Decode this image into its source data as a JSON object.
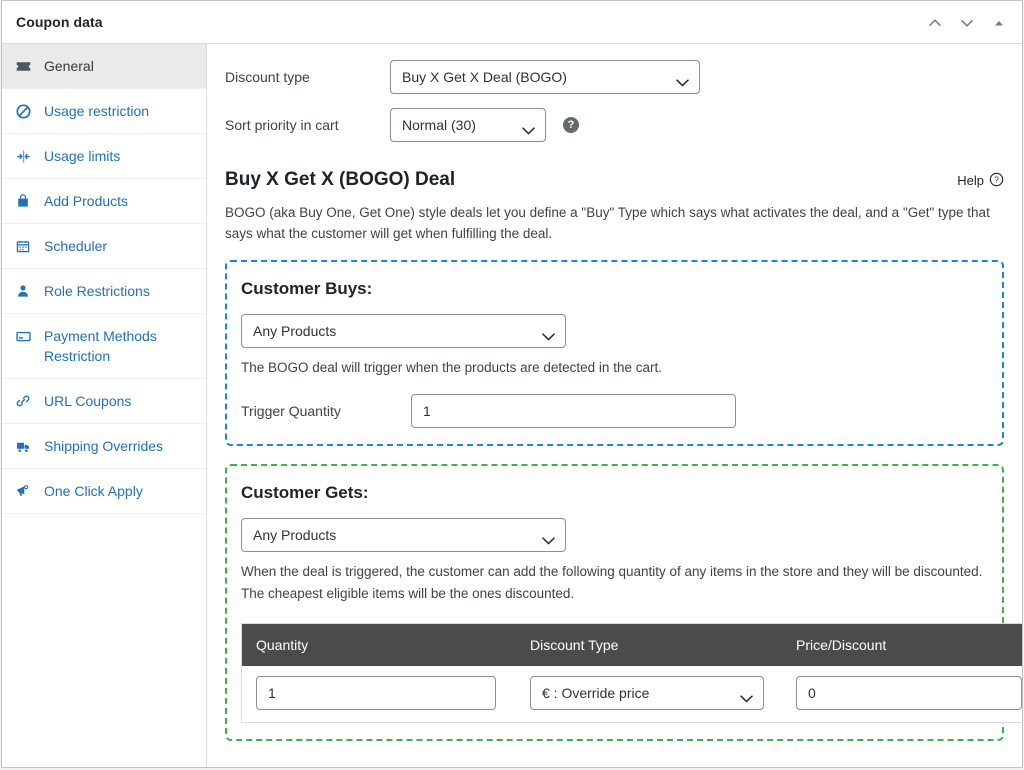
{
  "header": {
    "title": "Coupon data",
    "actions": [
      {
        "name": "move-up-icon",
        "label": "Move up"
      },
      {
        "name": "move-down-icon",
        "label": "Move down"
      },
      {
        "name": "toggle-panel-icon",
        "label": "Toggle panel"
      }
    ]
  },
  "sidebar": {
    "items": [
      {
        "label": "General",
        "icon": "ticket-icon",
        "active": true
      },
      {
        "label": "Usage restriction",
        "icon": "block-icon",
        "active": false
      },
      {
        "label": "Usage limits",
        "icon": "limits-icon",
        "active": false
      },
      {
        "label": "Add Products",
        "icon": "bag-icon",
        "active": false
      },
      {
        "label": "Scheduler",
        "icon": "calendar-icon",
        "active": false
      },
      {
        "label": "Role Restrictions",
        "icon": "user-icon",
        "active": false
      },
      {
        "label": "Payment Methods Restriction",
        "icon": "credit-card-icon",
        "active": false
      },
      {
        "label": "URL Coupons",
        "icon": "link-icon",
        "active": false
      },
      {
        "label": "Shipping Overrides",
        "icon": "truck-icon",
        "active": false
      },
      {
        "label": "One Click Apply",
        "icon": "megaphone-icon",
        "active": false
      }
    ]
  },
  "general": {
    "discount_type": {
      "label": "Discount type",
      "value": "Buy X Get X Deal (BOGO)",
      "options": [
        "Buy X Get X Deal (BOGO)"
      ]
    },
    "sort_priority": {
      "label": "Sort priority in cart",
      "value": "Normal (30)",
      "options": [
        "Normal (30)"
      ],
      "help_icon": "question-mark-icon"
    }
  },
  "bogo": {
    "title": "Buy X Get X (BOGO) Deal",
    "help_label": "Help",
    "help_icon": "question-circle-icon",
    "description": "BOGO (aka Buy One, Get One) style deals let you define a \"Buy\" Type which says what activates the deal, and a \"Get\" type that says what the customer will get when fulfilling the deal.",
    "buys": {
      "title": "Customer Buys:",
      "border_color": "#1e87c4",
      "select_value": "Any Products",
      "select_options": [
        "Any Products"
      ],
      "note": "The BOGO deal will trigger when the products are detected in the cart.",
      "trigger_label": "Trigger Quantity",
      "trigger_value": "1"
    },
    "gets": {
      "title": "Customer Gets:",
      "border_color": "#3db14c",
      "select_value": "Any Products",
      "select_options": [
        "Any Products"
      ],
      "note": "When the deal is triggered, the customer can add the following quantity of any items in the store and they will be discounted. The cheapest eligible items will be the ones discounted.",
      "table": {
        "headers": [
          "Quantity",
          "Discount Type",
          "Price/Discount"
        ],
        "rows": [
          {
            "quantity": "1",
            "discount_type": "€ : Override price",
            "discount_type_options": [
              "€ : Override price"
            ],
            "price": "0"
          }
        ]
      }
    }
  }
}
